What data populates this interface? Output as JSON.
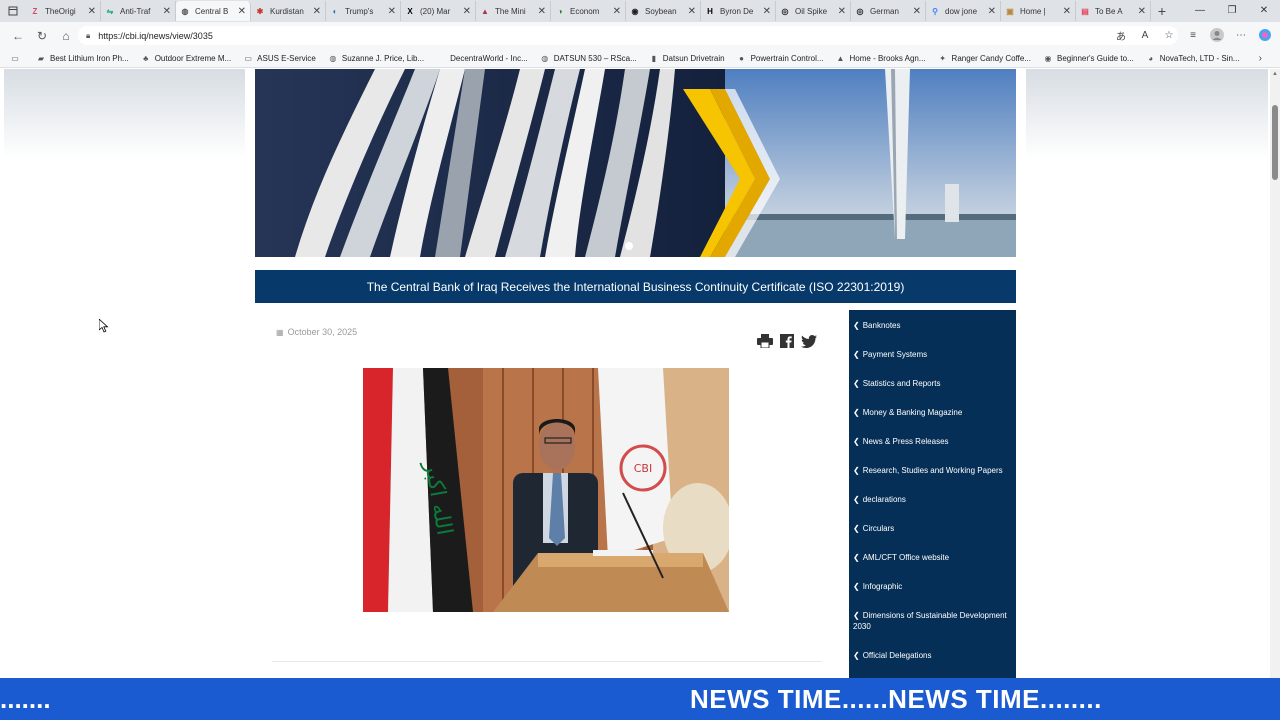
{
  "tabs": [
    {
      "title": "TheOrigi",
      "fav": "Z",
      "color": "#d64b6a"
    },
    {
      "title": "Anti-Traf",
      "fav": "⇋",
      "color": "#1aa37a"
    },
    {
      "title": "Central B",
      "fav": "◍",
      "color": "#555"
    },
    {
      "title": "Kurdistan",
      "fav": "✱",
      "color": "#c0392b"
    },
    {
      "title": "Trump's",
      "fav": "◐",
      "color": "#1e73be"
    },
    {
      "title": "(20) Mar",
      "fav": "X",
      "color": "#000"
    },
    {
      "title": "The Mini",
      "fav": "▲",
      "color": "#b0334d"
    },
    {
      "title": "Econom",
      "fav": "◑",
      "color": "#2e7d32"
    },
    {
      "title": "Soybean",
      "fav": "◉",
      "color": "#222"
    },
    {
      "title": "Byron De",
      "fav": "H",
      "color": "#000"
    },
    {
      "title": "Oil Spike",
      "fav": "◎",
      "color": "#222"
    },
    {
      "title": "German",
      "fav": "◎",
      "color": "#222"
    },
    {
      "title": "dow jone",
      "fav": "⚲",
      "color": "#3b82f6"
    },
    {
      "title": "Home |",
      "fav": "▣",
      "color": "#b88a3e"
    },
    {
      "title": "To Be A",
      "fav": "▤",
      "color": "#e0455c"
    }
  ],
  "active_tab_index": 2,
  "url": "https://cbi.iq/news/view/3035",
  "bookmarks": [
    {
      "label": "Best Lithium Iron Ph...",
      "icon": "▰"
    },
    {
      "label": "Outdoor Extreme M...",
      "icon": "♣"
    },
    {
      "label": "ASUS E-Service",
      "icon": "▭"
    },
    {
      "label": "Suzanne J. Price, Lib...",
      "icon": "◍"
    },
    {
      "label": "DecentraWorld - Inc...",
      "icon": ""
    },
    {
      "label": "DATSUN 530 – RSca...",
      "icon": "◍"
    },
    {
      "label": "Datsun Drivetrain",
      "icon": "▮"
    },
    {
      "label": "Powertrain Control...",
      "icon": "●"
    },
    {
      "label": "Home - Brooks Agn...",
      "icon": "▲"
    },
    {
      "label": "Ranger Candy Coffe...",
      "icon": "✦"
    },
    {
      "label": "Beginner's Guide to...",
      "icon": "◉"
    },
    {
      "label": "NovaTech, LTD - Sin...",
      "icon": "◕"
    }
  ],
  "article": {
    "headline": "The Central Bank of Iraq Receives the International Business Continuity Certificate (ISO 22301:2019)",
    "date": "October 30, 2025"
  },
  "menu": [
    "Banknotes",
    "Payment Systems",
    "Statistics and Reports",
    "Money & Banking Magazine",
    "News & Press Releases",
    "Research, Studies and Working Papers",
    "declarations",
    "Circulars",
    "AML/CFT Office website",
    "Infographic",
    "Dimensions of Sustainable Development 2030",
    "Official Delegations"
  ],
  "flag_text": "الله اكبر",
  "podium_logo": "CBI",
  "ticker": {
    "left": ".......",
    "main": "NEWS TIME......NEWS TIME........"
  },
  "colors": {
    "headline_bg": "#073a6b",
    "menu_bg": "#062f57",
    "ticker_bg": "#1a5bd1"
  }
}
